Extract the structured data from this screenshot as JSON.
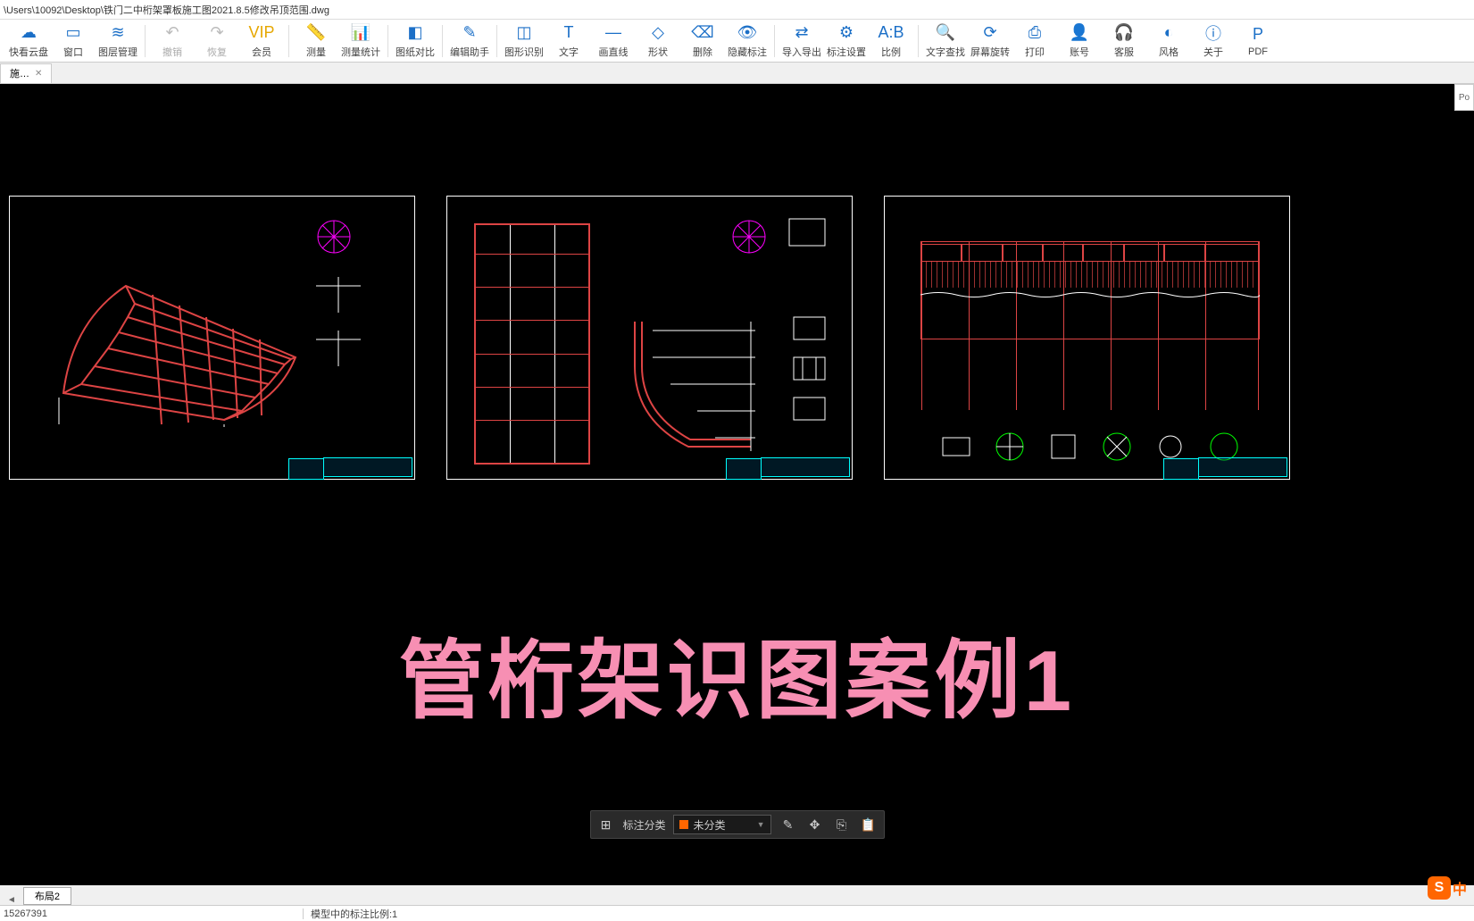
{
  "titlebar": {
    "path": "\\Users\\10092\\Desktop\\铁门二中桁架罩板施工图2021.8.5修改吊顶范围.dwg"
  },
  "toolbar": [
    {
      "id": "cloud",
      "label": "快看云盘",
      "glyph": "☁"
    },
    {
      "id": "window",
      "label": "窗口",
      "glyph": "▭"
    },
    {
      "id": "layers",
      "label": "图层管理",
      "glyph": "≋"
    },
    {
      "sep": true
    },
    {
      "id": "undo",
      "label": "撤销",
      "glyph": "↶",
      "disabled": true
    },
    {
      "id": "redo",
      "label": "恢复",
      "glyph": "↷",
      "disabled": true
    },
    {
      "id": "vip",
      "label": "会员",
      "glyph": "VIP",
      "vip": true
    },
    {
      "sep": true
    },
    {
      "id": "measure",
      "label": "测量",
      "glyph": "📏"
    },
    {
      "id": "measure-stats",
      "label": "测量统计",
      "glyph": "📊"
    },
    {
      "sep": true
    },
    {
      "id": "compare",
      "label": "图纸对比",
      "glyph": "◧"
    },
    {
      "sep": true
    },
    {
      "id": "edit-assist",
      "label": "编辑助手",
      "glyph": "✎"
    },
    {
      "sep": true
    },
    {
      "id": "shape-recog",
      "label": "图形识别",
      "glyph": "◫"
    },
    {
      "id": "text",
      "label": "文字",
      "glyph": "T"
    },
    {
      "id": "line",
      "label": "画直线",
      "glyph": "—"
    },
    {
      "id": "shape",
      "label": "形状",
      "glyph": "◇"
    },
    {
      "id": "delete",
      "label": "删除",
      "glyph": "⌫"
    },
    {
      "id": "hide-dim",
      "label": "隐藏标注",
      "glyph": "👁"
    },
    {
      "sep": true
    },
    {
      "id": "import-export",
      "label": "导入导出",
      "glyph": "⇄"
    },
    {
      "id": "dim-settings",
      "label": "标注设置",
      "glyph": "⚙"
    },
    {
      "id": "scale",
      "label": "比例",
      "glyph": "A:B"
    },
    {
      "sep": true
    },
    {
      "id": "text-search",
      "label": "文字查找",
      "glyph": "🔍"
    },
    {
      "id": "rotate",
      "label": "屏幕旋转",
      "glyph": "⟳"
    },
    {
      "id": "print",
      "label": "打印",
      "glyph": "⎙"
    },
    {
      "id": "account",
      "label": "账号",
      "glyph": "👤"
    },
    {
      "id": "support",
      "label": "客服",
      "glyph": "🎧"
    },
    {
      "id": "style",
      "label": "风格",
      "glyph": "◐"
    },
    {
      "id": "about",
      "label": "关于",
      "glyph": "ⓘ"
    },
    {
      "id": "pdf",
      "label": "PDF",
      "glyph": "P"
    }
  ],
  "file_tab": {
    "label": "施…"
  },
  "side_panel_hint": "Po",
  "overlay_title": "管桁架识图案例1",
  "bottom_toolbar": {
    "category_label": "标注分类",
    "category_value": "未分类"
  },
  "bottom_tabs": {
    "layout": "布局2"
  },
  "statusbar": {
    "left": "15267391",
    "scale": "模型中的标注比例:1"
  },
  "ime": {
    "badge": "S",
    "text": "中"
  }
}
